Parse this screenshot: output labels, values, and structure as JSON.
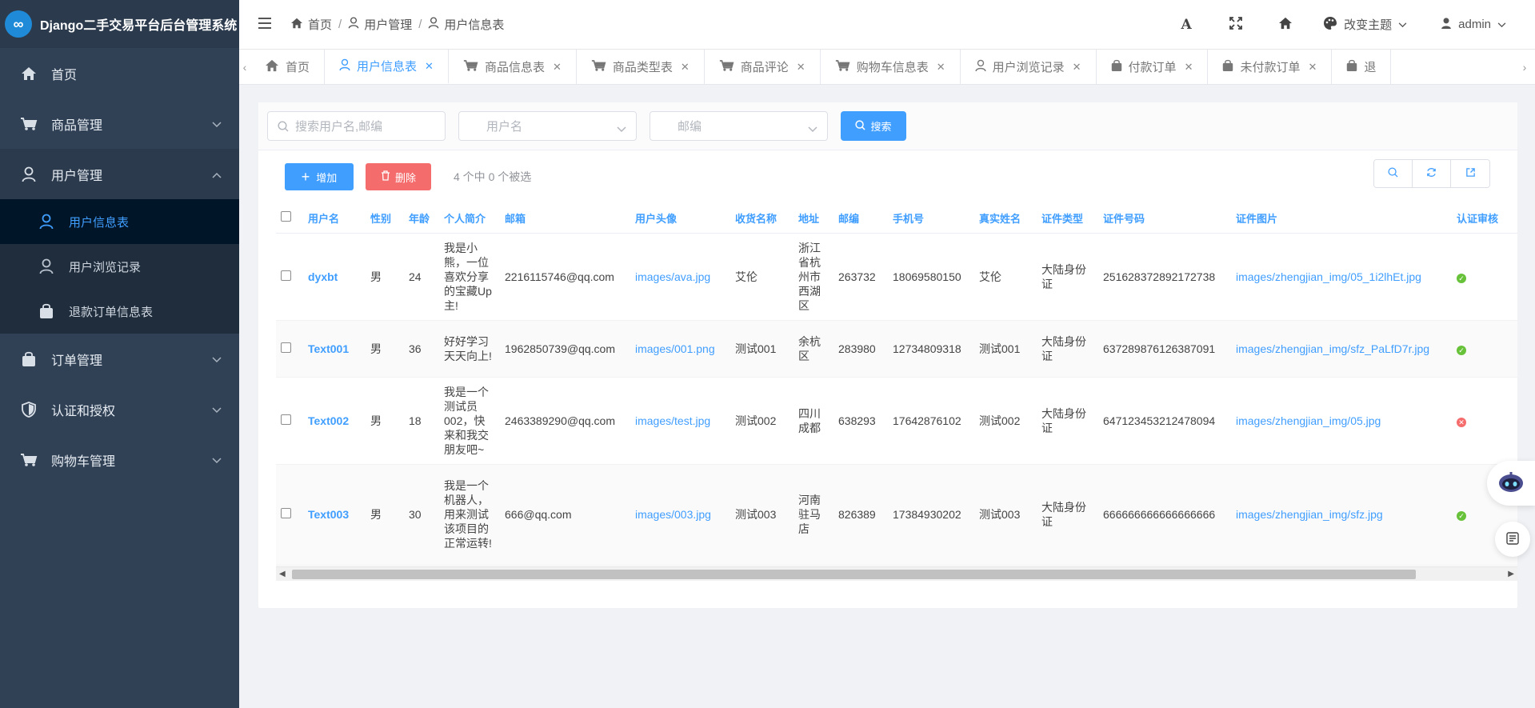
{
  "app": {
    "title": "Django二手交易平台后台管理系统",
    "logo_glyph": "∞"
  },
  "sidebar": {
    "items": [
      {
        "label": "首页",
        "icon": "home-icon"
      },
      {
        "label": "商品管理",
        "icon": "cart-icon"
      },
      {
        "label": "用户管理",
        "icon": "user-icon",
        "open": true,
        "children": [
          {
            "label": "用户信息表",
            "icon": "user-icon",
            "active": true
          },
          {
            "label": "用户浏览记录",
            "icon": "user-icon"
          },
          {
            "label": "退款订单信息表",
            "icon": "bag-icon"
          }
        ]
      },
      {
        "label": "订单管理",
        "icon": "bag-icon"
      },
      {
        "label": "认证和授权",
        "icon": "shield-icon"
      },
      {
        "label": "购物车管理",
        "icon": "cart-icon"
      }
    ]
  },
  "header": {
    "breadcrumb": [
      "首页",
      "用户管理",
      "用户信息表"
    ],
    "theme_label": "改变主题",
    "username": "admin",
    "font_glyph": "A"
  },
  "tabs": [
    {
      "label": "首页",
      "icon": "home-icon",
      "closable": false
    },
    {
      "label": "用户信息表",
      "icon": "user-icon",
      "closable": true,
      "active": true
    },
    {
      "label": "商品信息表",
      "icon": "cart-icon",
      "closable": true
    },
    {
      "label": "商品类型表",
      "icon": "cart-icon",
      "closable": true
    },
    {
      "label": "商品评论",
      "icon": "cart-icon",
      "closable": true
    },
    {
      "label": "购物车信息表",
      "icon": "cart-icon",
      "closable": true
    },
    {
      "label": "用户浏览记录",
      "icon": "user-icon",
      "closable": true
    },
    {
      "label": "付款订单",
      "icon": "bag-icon",
      "closable": true
    },
    {
      "label": "未付款订单",
      "icon": "bag-icon",
      "closable": true
    },
    {
      "label": "退",
      "icon": "bag-icon",
      "closable": false
    }
  ],
  "search": {
    "keyword_placeholder": "搜索用户名,邮编",
    "username_placeholder": "用户名",
    "zipcode_placeholder": "邮编",
    "search_label": "搜索"
  },
  "actions": {
    "add_label": "增加",
    "delete_label": "删除",
    "selection_info": "4 个中 0 个被选"
  },
  "table": {
    "columns": [
      "用户名",
      "性别",
      "年龄",
      "个人简介",
      "邮箱",
      "用户头像",
      "收货名称",
      "地址",
      "邮编",
      "手机号",
      "真实姓名",
      "证件类型",
      "证件号码",
      "证件图片",
      "认证审核"
    ],
    "rows": [
      {
        "username": "dyxbt",
        "gender": "男",
        "age": "24",
        "bio": "我是小熊，一位喜欢分享的宝藏Up主!",
        "email": "2216115746@qq.com",
        "avatar": "images/ava.jpg",
        "receiver": "艾伦",
        "address": "浙江省杭州市西湖区",
        "zip": "263732",
        "phone": "18069580150",
        "real_name": "艾伦",
        "id_type": "大陆身份证",
        "id_number": "251628372892172738",
        "id_image": "images/zhengjian_img/05_1i2lhEt.jpg",
        "verified": true
      },
      {
        "username": "Text001",
        "gender": "男",
        "age": "36",
        "bio": "好好学习天天向上!",
        "email": "1962850739@qq.com",
        "avatar": "images/001.png",
        "receiver": "测试001",
        "address": "余杭区",
        "zip": "283980",
        "phone": "12734809318",
        "real_name": "测试001",
        "id_type": "大陆身份证",
        "id_number": "637289876126387091",
        "id_image": "images/zhengjian_img/sfz_PaLfD7r.jpg",
        "verified": true
      },
      {
        "username": "Text002",
        "gender": "男",
        "age": "18",
        "bio": "我是一个测试员002，快来和我交朋友吧~",
        "email": "2463389290@qq.com",
        "avatar": "images/test.jpg",
        "receiver": "测试002",
        "address": "四川成都",
        "zip": "638293",
        "phone": "17642876102",
        "real_name": "测试002",
        "id_type": "大陆身份证",
        "id_number": "647123453212478094",
        "id_image": "images/zhengjian_img/05.jpg",
        "verified": false
      },
      {
        "username": "Text003",
        "gender": "男",
        "age": "30",
        "bio": "我是一个机器人，用来测试该项目的正常运转!",
        "email": "666@qq.com",
        "avatar": "images/003.jpg",
        "receiver": "测试003",
        "address": "河南驻马店",
        "zip": "826389",
        "phone": "17384930202",
        "real_name": "测试003",
        "id_type": "大陆身份证",
        "id_number": "666666666666666666",
        "id_image": "images/zhengjian_img/sfz.jpg",
        "verified": true
      }
    ]
  },
  "colors": {
    "primary": "#409eff",
    "danger": "#f56c6c",
    "success": "#67c23a",
    "sidebar_bg": "#304156",
    "sidebar_active": "#001528"
  }
}
